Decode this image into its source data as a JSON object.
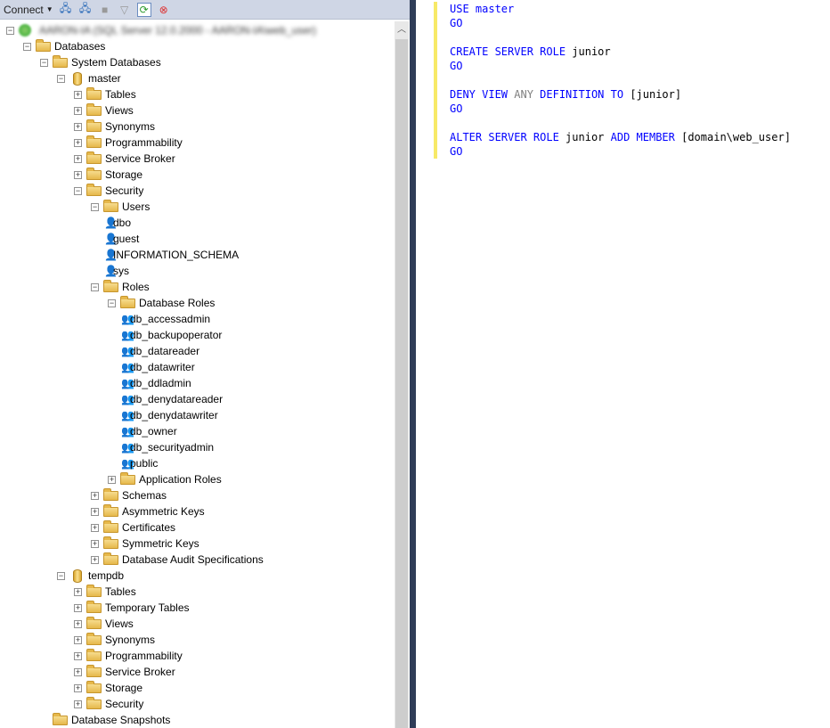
{
  "toolbar": {
    "connect_label": "Connect",
    "icons": [
      "connect-object-explorer-icon",
      "disconnect-icon",
      "stop-icon",
      "filter-icon",
      "refresh-icon",
      "close-script-icon"
    ]
  },
  "tree": [
    {
      "level": 0,
      "exp": "minus",
      "icon": "server",
      "label": "AARON-IA (SQL Server 12.0.2000 - AARON-IA\\web_user)",
      "blurred": true
    },
    {
      "level": 1,
      "exp": "minus",
      "icon": "folder",
      "label": "Databases"
    },
    {
      "level": 2,
      "exp": "minus",
      "icon": "folder",
      "label": "System Databases"
    },
    {
      "level": 3,
      "exp": "minus",
      "icon": "db",
      "label": "master"
    },
    {
      "level": 4,
      "exp": "plus",
      "icon": "folder",
      "label": "Tables"
    },
    {
      "level": 4,
      "exp": "plus",
      "icon": "folder",
      "label": "Views"
    },
    {
      "level": 4,
      "exp": "plus",
      "icon": "folder",
      "label": "Synonyms"
    },
    {
      "level": 4,
      "exp": "plus",
      "icon": "folder",
      "label": "Programmability"
    },
    {
      "level": 4,
      "exp": "plus",
      "icon": "folder",
      "label": "Service Broker"
    },
    {
      "level": 4,
      "exp": "plus",
      "icon": "folder",
      "label": "Storage"
    },
    {
      "level": 4,
      "exp": "minus",
      "icon": "folder",
      "label": "Security"
    },
    {
      "level": 5,
      "exp": "minus",
      "icon": "folder",
      "label": "Users"
    },
    {
      "level": 6,
      "exp": "none",
      "icon": "user",
      "label": "dbo"
    },
    {
      "level": 6,
      "exp": "none",
      "icon": "user",
      "label": "guest"
    },
    {
      "level": 6,
      "exp": "none",
      "icon": "user",
      "label": "INFORMATION_SCHEMA"
    },
    {
      "level": 6,
      "exp": "none",
      "icon": "user",
      "label": "sys"
    },
    {
      "level": 5,
      "exp": "minus",
      "icon": "folder",
      "label": "Roles"
    },
    {
      "level": 6,
      "exp": "minus",
      "icon": "folder",
      "label": "Database Roles"
    },
    {
      "level": 7,
      "exp": "none",
      "icon": "role",
      "label": "db_accessadmin"
    },
    {
      "level": 7,
      "exp": "none",
      "icon": "role",
      "label": "db_backupoperator"
    },
    {
      "level": 7,
      "exp": "none",
      "icon": "role",
      "label": "db_datareader"
    },
    {
      "level": 7,
      "exp": "none",
      "icon": "role",
      "label": "db_datawriter"
    },
    {
      "level": 7,
      "exp": "none",
      "icon": "role",
      "label": "db_ddladmin"
    },
    {
      "level": 7,
      "exp": "none",
      "icon": "role",
      "label": "db_denydatareader"
    },
    {
      "level": 7,
      "exp": "none",
      "icon": "role",
      "label": "db_denydatawriter"
    },
    {
      "level": 7,
      "exp": "none",
      "icon": "role",
      "label": "db_owner"
    },
    {
      "level": 7,
      "exp": "none",
      "icon": "role",
      "label": "db_securityadmin"
    },
    {
      "level": 7,
      "exp": "none",
      "icon": "role",
      "label": "public"
    },
    {
      "level": 6,
      "exp": "plus",
      "icon": "folder",
      "label": "Application Roles"
    },
    {
      "level": 5,
      "exp": "plus",
      "icon": "folder",
      "label": "Schemas"
    },
    {
      "level": 5,
      "exp": "plus",
      "icon": "folder",
      "label": "Asymmetric Keys"
    },
    {
      "level": 5,
      "exp": "plus",
      "icon": "folder",
      "label": "Certificates"
    },
    {
      "level": 5,
      "exp": "plus",
      "icon": "folder",
      "label": "Symmetric Keys"
    },
    {
      "level": 5,
      "exp": "plus",
      "icon": "folder",
      "label": "Database Audit Specifications"
    },
    {
      "level": 3,
      "exp": "minus",
      "icon": "db",
      "label": "tempdb"
    },
    {
      "level": 4,
      "exp": "plus",
      "icon": "folder",
      "label": "Tables"
    },
    {
      "level": 4,
      "exp": "plus",
      "icon": "folder",
      "label": "Temporary Tables"
    },
    {
      "level": 4,
      "exp": "plus",
      "icon": "folder",
      "label": "Views"
    },
    {
      "level": 4,
      "exp": "plus",
      "icon": "folder",
      "label": "Synonyms"
    },
    {
      "level": 4,
      "exp": "plus",
      "icon": "folder",
      "label": "Programmability"
    },
    {
      "level": 4,
      "exp": "plus",
      "icon": "folder",
      "label": "Service Broker"
    },
    {
      "level": 4,
      "exp": "plus",
      "icon": "folder",
      "label": "Storage"
    },
    {
      "level": 4,
      "exp": "plus",
      "icon": "folder",
      "label": "Security"
    },
    {
      "level": 2,
      "exp": "none",
      "icon": "folder",
      "label": "Database Snapshots"
    }
  ],
  "editor": {
    "lines": [
      [
        [
          "kw",
          "USE "
        ],
        [
          "kw",
          "master"
        ]
      ],
      [
        [
          "kw",
          "GO"
        ]
      ],
      [],
      [
        [
          "kw",
          "CREATE SERVER ROLE "
        ],
        [
          "tx",
          "junior"
        ]
      ],
      [
        [
          "kw",
          "GO"
        ]
      ],
      [],
      [
        [
          "kw",
          "DENY VIEW "
        ],
        [
          "gr",
          "ANY "
        ],
        [
          "kw",
          "DEFINITION TO "
        ],
        [
          "tx",
          "[junior]"
        ]
      ],
      [
        [
          "kw",
          "GO"
        ]
      ],
      [],
      [
        [
          "kw",
          "ALTER SERVER ROLE "
        ],
        [
          "tx",
          "junior "
        ],
        [
          "kw",
          "ADD MEMBER "
        ],
        [
          "tx",
          "[domain\\web_user]"
        ]
      ],
      [
        [
          "kw",
          "GO"
        ]
      ]
    ]
  },
  "colors": {
    "keyword": "#0000ff",
    "gray_keyword": "#808080",
    "change_bar": "#f7e967",
    "splitter": "#2f3d58",
    "toolbar": "#cfd6e5"
  }
}
